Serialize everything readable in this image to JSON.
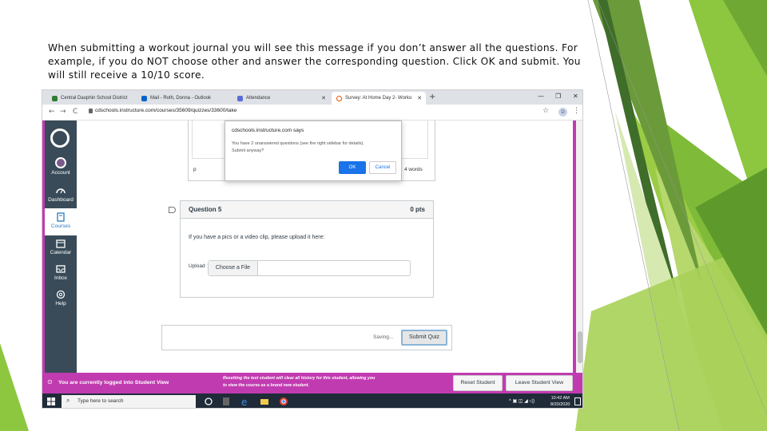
{
  "caption": {
    "line1": "When submitting a workout journal you will see this message if you don’t answer all the questions.  For",
    "line2": "example, if you do NOT choose other and answer the corresponding question. Click OK and submit.  You",
    "line3": "will still receive a 10/10 score."
  },
  "browser": {
    "tabs": [
      {
        "label": "Central Dauphin School District"
      },
      {
        "label": "Mail - Roth, Donna - Outlook"
      },
      {
        "label": "Attendance"
      },
      {
        "label": "Survey: At Home Day 2- Worko"
      }
    ],
    "url": "cdschools.instructure.com/courses/35609/quizzes/33600/take",
    "profile_initial": "D"
  },
  "nav": {
    "items": [
      "Account",
      "Dashboard",
      "Courses",
      "Calendar",
      "Inbox",
      "Help"
    ]
  },
  "dialog": {
    "title": "cdschools.instructure.com says",
    "message_line1": "You have 2 unanswered questions (see the right sidebar for details).",
    "message_line2": "Submit anyway?",
    "ok_label": "OK",
    "cancel_label": "Cancel"
  },
  "quiz": {
    "previous": {
      "path": "p",
      "word_count": "4 words"
    },
    "question": {
      "title": "Question 5",
      "points": "0 pts",
      "text": "If you have a pics or a video clip, please upload it here:",
      "upload_label": "Upload",
      "choose_file_label": "Choose a File"
    },
    "saving_text": "Saving...",
    "submit_label": "Submit Quiz"
  },
  "student_view": {
    "message": "You are currently logged into Student View",
    "note_line1": "Resetting the test student will clear all history for this student, allowing you",
    "note_line2": "to view the course as a brand new student.",
    "reset_label": "Reset Student",
    "leave_label": "Leave Student View"
  },
  "taskbar": {
    "search_placeholder": "Type here to search",
    "time": "10:42 AM",
    "date": "8/20/2020"
  },
  "colors": {
    "student_view_magenta": "#c13bb0",
    "canvas_nav": "#394b58",
    "accent_green": "#8dc63f",
    "ok_blue": "#1a73e8"
  }
}
